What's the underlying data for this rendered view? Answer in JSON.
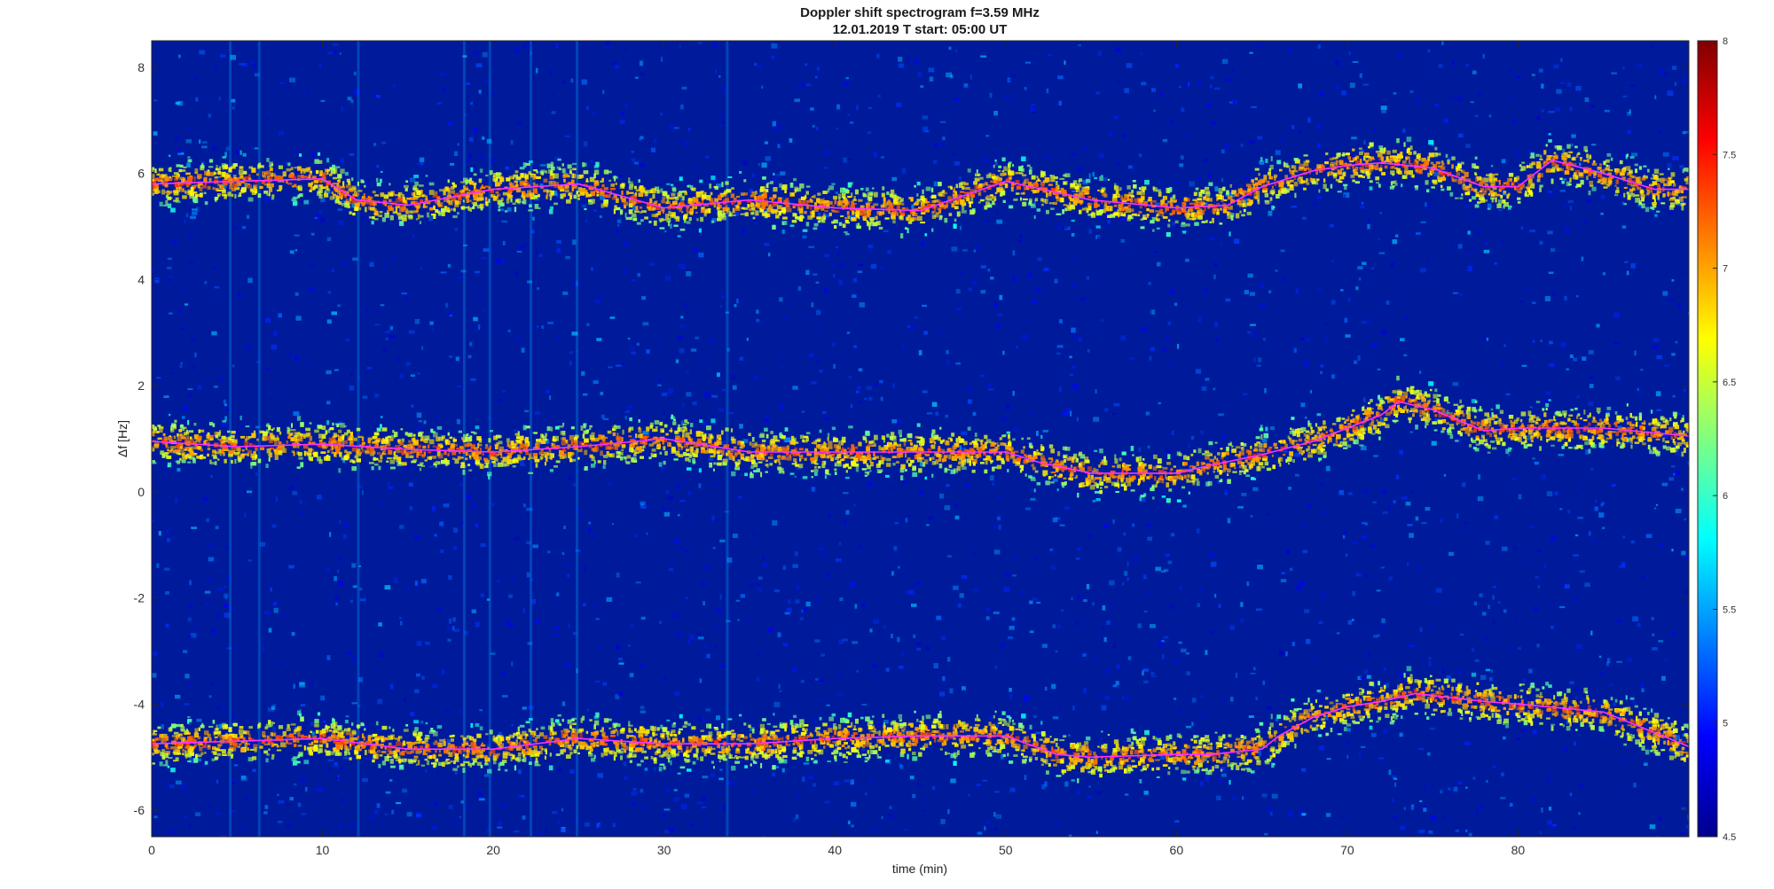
{
  "chart_data": {
    "type": "heatmap",
    "title": "Doppler shift spectrogram f=3.59 MHz",
    "subtitle": "12.01.2019   T start: 05:00 UT",
    "xlabel": "time (min)",
    "ylabel": "Δf [Hz]",
    "xlim": [
      0,
      90
    ],
    "ylim": [
      -6.5,
      8.5
    ],
    "x_ticks": [
      0,
      10,
      20,
      30,
      40,
      50,
      60,
      70,
      80
    ],
    "y_ticks": [
      -6,
      -4,
      -2,
      0,
      2,
      4,
      6,
      8
    ],
    "colorbar": {
      "colormap": "jet",
      "range": [
        4.5,
        8
      ],
      "ticks": [
        4.5,
        5,
        5.5,
        6,
        6.5,
        7,
        7.5,
        8
      ]
    },
    "series": [
      {
        "band": "upper",
        "trace_color": "#ff33ff",
        "x": [
          0,
          5,
          10,
          12,
          15,
          20,
          25,
          30,
          35,
          40,
          45,
          50,
          55,
          60,
          63,
          65,
          68,
          70,
          72,
          75,
          78,
          80,
          82,
          85,
          88,
          90
        ],
        "y": [
          5.8,
          5.85,
          5.9,
          5.5,
          5.4,
          5.7,
          5.8,
          5.35,
          5.5,
          5.35,
          5.3,
          5.85,
          5.5,
          5.35,
          5.4,
          5.75,
          6.05,
          6.15,
          6.2,
          6.1,
          5.75,
          5.75,
          6.25,
          6.0,
          5.7,
          5.7
        ]
      },
      {
        "band": "middle",
        "trace_color": "#ff33ff",
        "x": [
          0,
          5,
          10,
          15,
          20,
          25,
          30,
          35,
          40,
          45,
          50,
          52,
          55,
          60,
          62,
          65,
          68,
          70,
          72,
          73,
          75,
          78,
          80,
          85,
          90
        ],
        "y": [
          0.95,
          0.85,
          0.9,
          0.8,
          0.75,
          0.85,
          1.0,
          0.75,
          0.75,
          0.75,
          0.75,
          0.55,
          0.35,
          0.35,
          0.5,
          0.7,
          0.95,
          1.2,
          1.45,
          1.7,
          1.55,
          1.15,
          1.2,
          1.2,
          1.05
        ]
      },
      {
        "band": "lower",
        "trace_color": "#ff33ff",
        "x": [
          0,
          5,
          10,
          15,
          20,
          25,
          30,
          35,
          40,
          45,
          50,
          53,
          55,
          60,
          62,
          65,
          66,
          68,
          70,
          72,
          74,
          78,
          80,
          85,
          90
        ],
        "y": [
          -4.75,
          -4.7,
          -4.65,
          -4.85,
          -4.85,
          -4.65,
          -4.75,
          -4.75,
          -4.65,
          -4.6,
          -4.6,
          -4.95,
          -5.0,
          -4.95,
          -4.95,
          -4.85,
          -4.6,
          -4.25,
          -4.05,
          -3.95,
          -3.8,
          -3.95,
          -4.0,
          -4.15,
          -4.8
        ]
      }
    ]
  }
}
